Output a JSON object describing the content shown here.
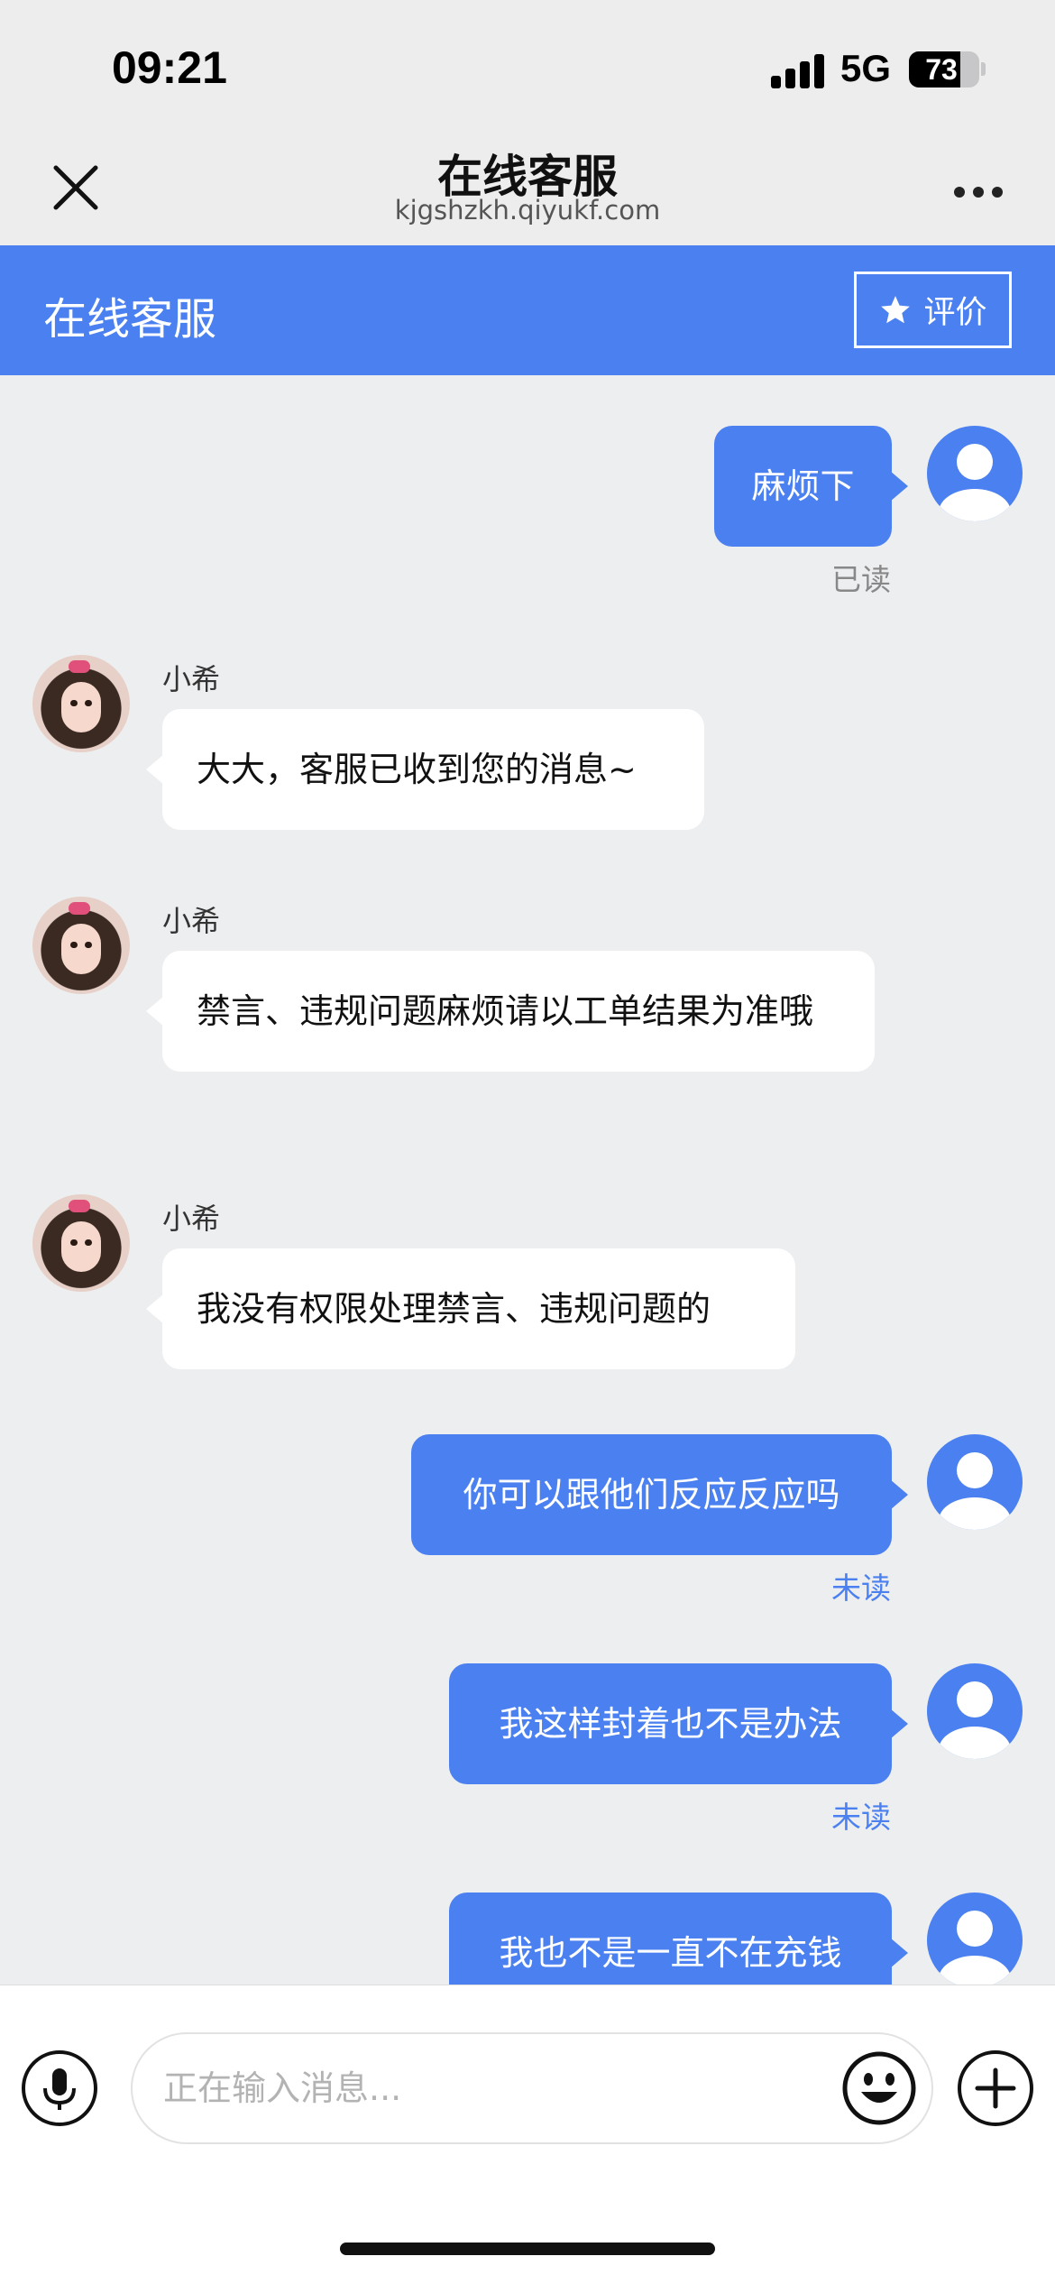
{
  "status_bar": {
    "time": "09:21",
    "network": "5G",
    "battery": "73",
    "battery_level": 0.73
  },
  "nav": {
    "title": "在线客服",
    "subtitle": "kjgshzkh.qiyukf.com",
    "close_icon": "close-icon",
    "more_icon": "more-dots-icon"
  },
  "chat_header": {
    "title": "在线客服",
    "rate_label": "评价",
    "rate_icon": "star-icon"
  },
  "messages": [
    {
      "side": "out",
      "text": "麻烦下",
      "status": "已读"
    },
    {
      "side": "in",
      "sender": "小希",
      "text": "大大，客服已收到您的消息~"
    },
    {
      "side": "in",
      "sender": "小希",
      "text": "禁言、违规问题麻烦请以工单结果为准哦"
    },
    {
      "side": "in",
      "sender": "小希",
      "text": "我没有权限处理禁言、违规问题的"
    },
    {
      "side": "out",
      "text": "你可以跟他们反应反应吗",
      "status": "未读"
    },
    {
      "side": "out",
      "text": "我这样封着也不是办法",
      "status": "未读"
    },
    {
      "side": "out",
      "text": "我也不是一直不在充钱"
    }
  ],
  "input_bar": {
    "placeholder": "正在输入消息...",
    "mic_icon": "microphone-icon",
    "emoji_icon": "emoji-icon",
    "plus_icon": "plus-icon"
  },
  "colors": {
    "accent": "#4b80f0",
    "chat_bg": "#edeef0",
    "unread": "#4b80f0",
    "read": "#888888"
  }
}
